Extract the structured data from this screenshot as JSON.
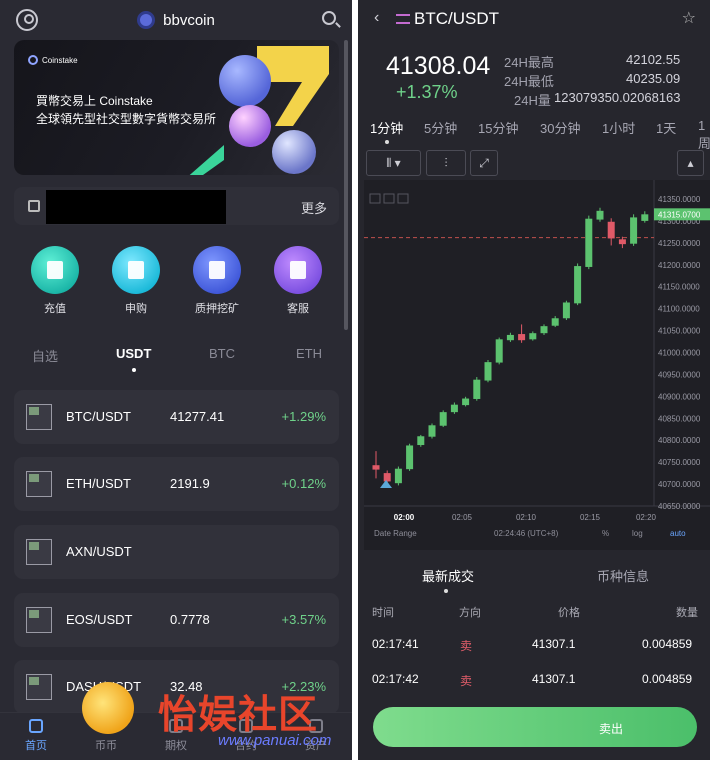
{
  "left": {
    "brand": "bbvcoin",
    "banner": {
      "logo_text": "Coinstake",
      "line1": "買幣交易上 Coinstake",
      "line2": "全球領先型社交型數字貨幣交易所"
    },
    "notice_more": "更多",
    "quick": [
      {
        "label": "充值",
        "icon": "book-icon"
      },
      {
        "label": "申购",
        "icon": "cart-icon"
      },
      {
        "label": "质押挖矿",
        "icon": "pickaxe-icon"
      },
      {
        "label": "客服",
        "icon": "chat-icon"
      }
    ],
    "tabs": [
      "自选",
      "USDT",
      "BTC",
      "ETH"
    ],
    "markets": [
      {
        "pair": "BTC/USDT",
        "price": "41277.41",
        "change": "+1.29%"
      },
      {
        "pair": "ETH/USDT",
        "price": "2191.9",
        "change": "+0.12%"
      },
      {
        "pair": "AXN/USDT",
        "price": "",
        "change": ""
      },
      {
        "pair": "EOS/USDT",
        "price": "0.7778",
        "change": "+3.57%"
      },
      {
        "pair": "DASH/USDT",
        "price": "32.48",
        "change": "+2.23%"
      }
    ],
    "nav": [
      "首页",
      "币币",
      "期权",
      "合约",
      "资产"
    ]
  },
  "right": {
    "pair": "BTC/USDT",
    "price": "41308.04",
    "change": "+1.37%",
    "high_k": "24H最高",
    "high_v": "42102.55",
    "low_k": "24H最低",
    "low_v": "40235.09",
    "vol_k": "24H量",
    "vol_v": "123079350.02068163",
    "intervals": [
      "1分钟",
      "5分钟",
      "15分钟",
      "30分钟",
      "1小时",
      "1天",
      "1周"
    ],
    "footer": {
      "range": "Date Range",
      "time": "02:24:46 (UTC+8)",
      "pct": "%",
      "log": "log",
      "auto": "auto"
    },
    "trade_tabs": [
      "最新成交",
      "币种信息"
    ],
    "trade_headers": [
      "时间",
      "方向",
      "价格",
      "数量"
    ],
    "trades": [
      {
        "time": "02:17:41",
        "side": "卖",
        "price": "41307.1",
        "qty": "0.004859"
      },
      {
        "time": "02:17:42",
        "side": "卖",
        "price": "41307.1",
        "qty": "0.004859"
      }
    ],
    "sell_label": "卖出",
    "watermark": {
      "title": "怡娱社区",
      "url": "www.panuai.com"
    }
  },
  "chart_data": {
    "type": "candlestick",
    "x": [
      "02:00",
      "02:05",
      "02:10",
      "02:15",
      "02:20"
    ],
    "ylim": [
      40650,
      41375
    ],
    "ticks": [
      "41350.0000",
      "41300.0000",
      "41250.0000",
      "41200.0000",
      "41150.0000",
      "41100.0000",
      "41050.0000",
      "41000.0000",
      "40950.0000",
      "40900.0000",
      "40850.0000",
      "40800.0000",
      "40750.0000",
      "40700.0000",
      "40650.0000"
    ],
    "last_label": "41315.0700",
    "ref_line": 41262,
    "candles": [
      {
        "o": 40743,
        "c": 40733,
        "h": 40775,
        "l": 40713
      },
      {
        "o": 40725,
        "c": 40706,
        "h": 40731,
        "l": 40700
      },
      {
        "o": 40702,
        "c": 40735,
        "h": 40740,
        "l": 40697
      },
      {
        "o": 40734,
        "c": 40788,
        "h": 40792,
        "l": 40730
      },
      {
        "o": 40789,
        "c": 40809,
        "h": 40812,
        "l": 40785
      },
      {
        "o": 40808,
        "c": 40834,
        "h": 40838,
        "l": 40804
      },
      {
        "o": 40833,
        "c": 40864,
        "h": 40868,
        "l": 40830
      },
      {
        "o": 40864,
        "c": 40881,
        "h": 40886,
        "l": 40860
      },
      {
        "o": 40880,
        "c": 40895,
        "h": 40899,
        "l": 40877
      },
      {
        "o": 40894,
        "c": 40938,
        "h": 40944,
        "l": 40890
      },
      {
        "o": 40936,
        "c": 40978,
        "h": 40983,
        "l": 40932
      },
      {
        "o": 40977,
        "c": 41030,
        "h": 41034,
        "l": 40973
      },
      {
        "o": 41028,
        "c": 41040,
        "h": 41045,
        "l": 41024
      },
      {
        "o": 41042,
        "c": 41028,
        "h": 41064,
        "l": 41022
      },
      {
        "o": 41030,
        "c": 41044,
        "h": 41048,
        "l": 41027
      },
      {
        "o": 41044,
        "c": 41060,
        "h": 41064,
        "l": 41040
      },
      {
        "o": 41061,
        "c": 41078,
        "h": 41083,
        "l": 41058
      },
      {
        "o": 41078,
        "c": 41114,
        "h": 41118,
        "l": 41074
      },
      {
        "o": 41112,
        "c": 41197,
        "h": 41203,
        "l": 41108
      },
      {
        "o": 41195,
        "c": 41305,
        "h": 41312,
        "l": 41190
      },
      {
        "o": 41303,
        "c": 41323,
        "h": 41330,
        "l": 41298
      },
      {
        "o": 41298,
        "c": 41260,
        "h": 41306,
        "l": 41244
      },
      {
        "o": 41258,
        "c": 41247,
        "h": 41264,
        "l": 41238
      },
      {
        "o": 41248,
        "c": 41308,
        "h": 41315,
        "l": 41243
      },
      {
        "o": 41300,
        "c": 41315,
        "h": 41322,
        "l": 41296
      }
    ]
  }
}
